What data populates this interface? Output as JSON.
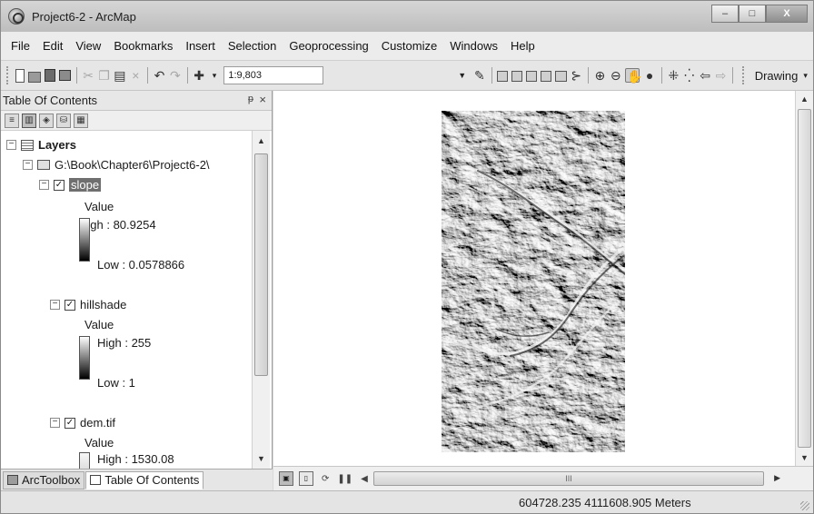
{
  "window": {
    "title": "Project6-2 - ArcMap",
    "controls": {
      "minimize": "–",
      "maximize": "□",
      "close": "X"
    }
  },
  "menu": [
    "File",
    "Edit",
    "View",
    "Bookmarks",
    "Insert",
    "Selection",
    "Geoprocessing",
    "Customize",
    "Windows",
    "Help"
  ],
  "toolbar": {
    "scale": "1:9,803",
    "drawing_label": "Drawing"
  },
  "toc": {
    "title": "Table Of Contents",
    "pin": "ᵽ",
    "close": "×",
    "root": "Layers",
    "folder": "G:\\Book\\Chapter6\\Project6-2\\",
    "layers": [
      {
        "name": "slope",
        "value_label": "Value",
        "high": "High : 80.9254",
        "low": "Low : 0.0578866"
      },
      {
        "name": "hillshade",
        "value_label": "Value",
        "high": "High : 255",
        "low": "Low : 1"
      },
      {
        "name": "dem.tif",
        "value_label": "Value",
        "high": "High : 1530.08"
      }
    ],
    "tabs": [
      "ArcToolbox",
      "Table Of Contents"
    ]
  },
  "map": {
    "scroll_label": "III"
  },
  "status": {
    "coordinates": "604728.235  4111608.905 Meters"
  },
  "icons": [
    "new-document-icon",
    "open-folder-icon",
    "save-icon",
    "print-icon",
    "cut-icon",
    "copy-icon",
    "paste-icon",
    "delete-icon",
    "undo-icon",
    "redo-icon",
    "add-data-icon",
    "editor-icon",
    "table-icon",
    "zoom-in-icon",
    "zoom-out-icon",
    "pan-icon",
    "full-extent-icon",
    "back-icon",
    "forward-icon"
  ]
}
